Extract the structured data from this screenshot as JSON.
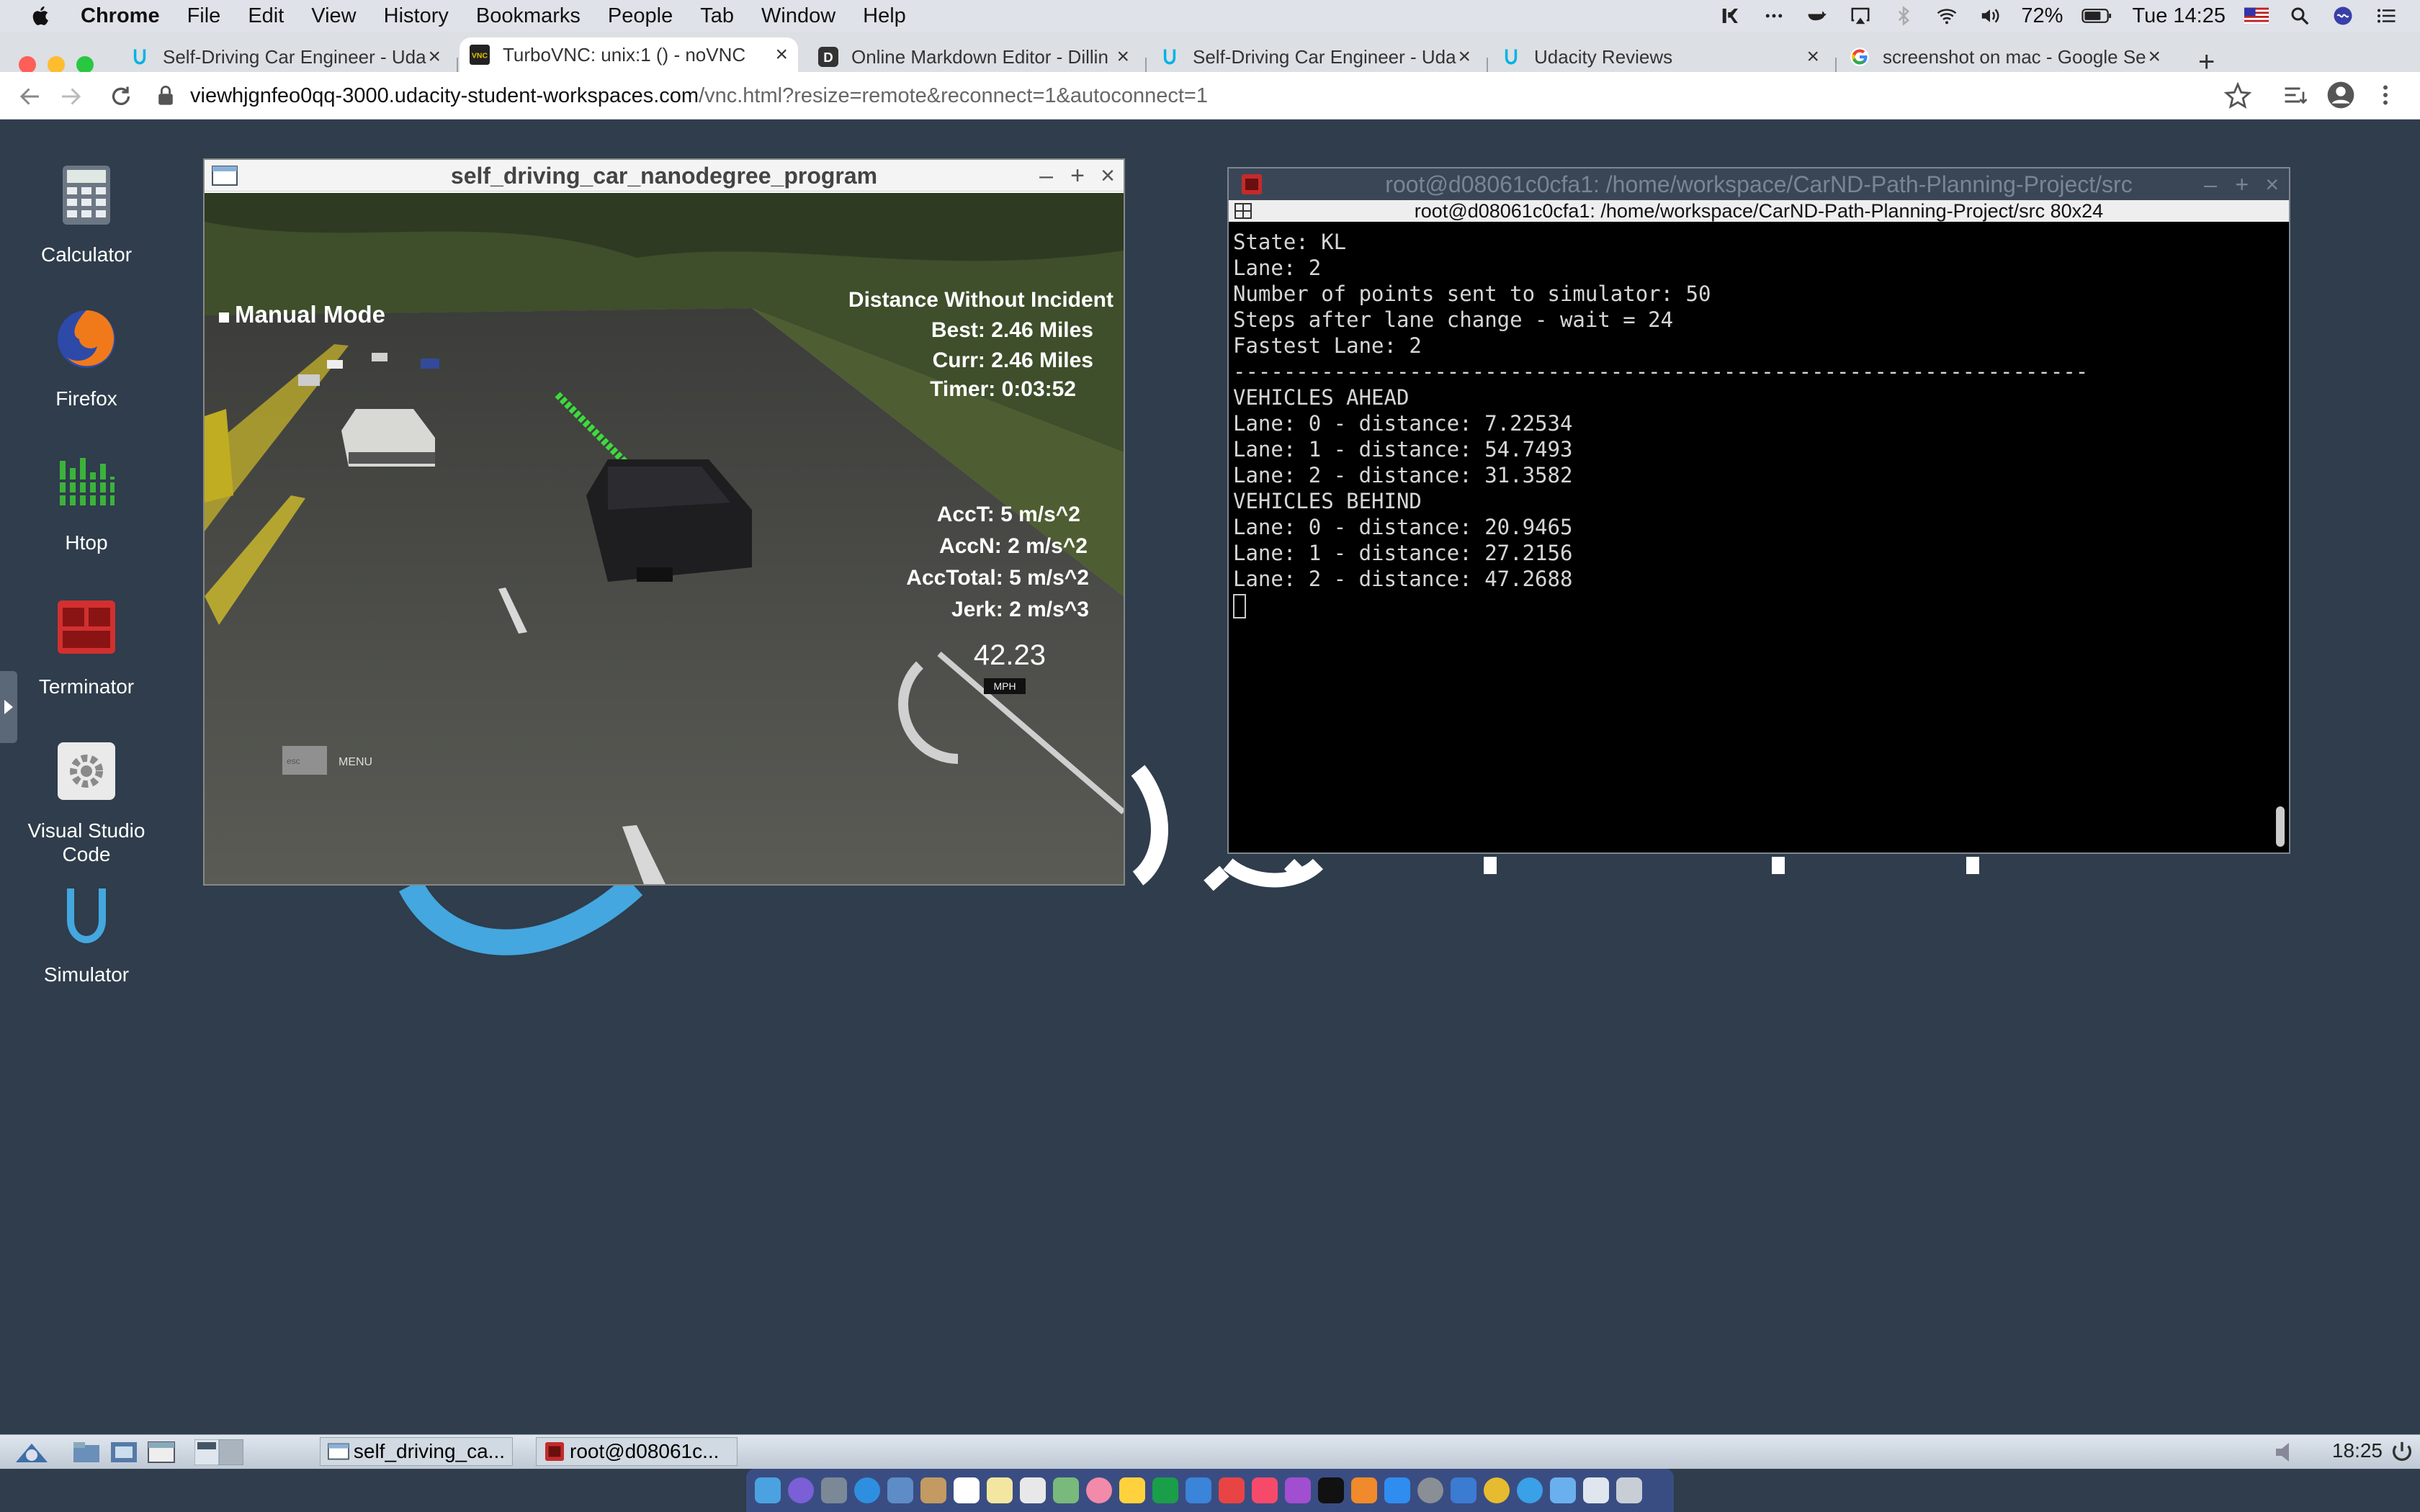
{
  "menubar": {
    "app": "Chrome",
    "items": [
      "File",
      "Edit",
      "View",
      "History",
      "Bookmarks",
      "People",
      "Tab",
      "Window",
      "Help"
    ],
    "battery": "72%",
    "datetime": "Tue 14:25"
  },
  "tabs": [
    {
      "title": "Self-Driving Car Engineer - Uda",
      "icon": "udacity-icon"
    },
    {
      "title": "TurboVNC: unix:1 () - noVNC",
      "icon": "vnc-icon"
    },
    {
      "title": "Online Markdown Editor - Dillin",
      "icon": "dillinger-icon"
    },
    {
      "title": "Self-Driving Car Engineer - Uda",
      "icon": "udacity-icon"
    },
    {
      "title": "Udacity Reviews",
      "icon": "udacity-icon"
    },
    {
      "title": "screenshot on mac - Google Se",
      "icon": "google-icon"
    }
  ],
  "address": {
    "host": "viewhjgnfeo0qq-3000.udacity-student-workspaces.com",
    "path": "/vnc.html?resize=remote&reconnect=1&autoconnect=1"
  },
  "desktop_icons": [
    {
      "label": "Calculator",
      "color": "#5e6a7a"
    },
    {
      "label": "Firefox",
      "color": "#e86a1a"
    },
    {
      "label": "Htop",
      "color": "#2d8a2d"
    },
    {
      "label": "Terminator",
      "color": "#c42b2b"
    },
    {
      "label": "Visual Studio\nCode",
      "color": "#e8e8e8"
    },
    {
      "label": "Simulator",
      "color": "#2f3d4c"
    }
  ],
  "sim": {
    "title": "self_driving_car_nanodegree_program",
    "mode": "Manual Mode",
    "hud_title": "Distance Without Incident",
    "best": "Best: 2.46 Miles",
    "curr": "Curr: 2.46 Miles",
    "timer": "Timer: 0:03:52",
    "acct": "AccT: 5 m/s^2",
    "accn": "AccN: 2 m/s^2",
    "acctotal": "AccTotal: 5 m/s^2",
    "jerk": "Jerk: 2 m/s^3",
    "speed": "42.23",
    "speed_unit": "MPH",
    "menu": "MENU",
    "esc": "esc"
  },
  "terminal": {
    "title": "root@d08061c0cfa1: /home/workspace/CarND-Path-Planning-Project/src",
    "subtitle": "root@d08061c0cfa1: /home/workspace/CarND-Path-Planning-Project/src 80x24",
    "lines": [
      "State: KL",
      "Lane: 2",
      "Number of points sent to simulator: 50",
      "Steps after lane change - wait = 24",
      "Fastest Lane: 2",
      "--------------------------------------------------------------------",
      "VEHICLES AHEAD",
      "Lane: 0 - distance: 7.22534",
      "Lane: 1 - distance: 54.7493",
      "Lane: 2 - distance: 31.3582",
      "VEHICLES BEHIND",
      "Lane: 0 - distance: 20.9465",
      "Lane: 1 - distance: 27.2156",
      "Lane: 2 - distance: 47.2688"
    ]
  },
  "taskbar": {
    "task1": "self_driving_ca...",
    "task2": "root@d08061c...",
    "clock": "18:25"
  }
}
